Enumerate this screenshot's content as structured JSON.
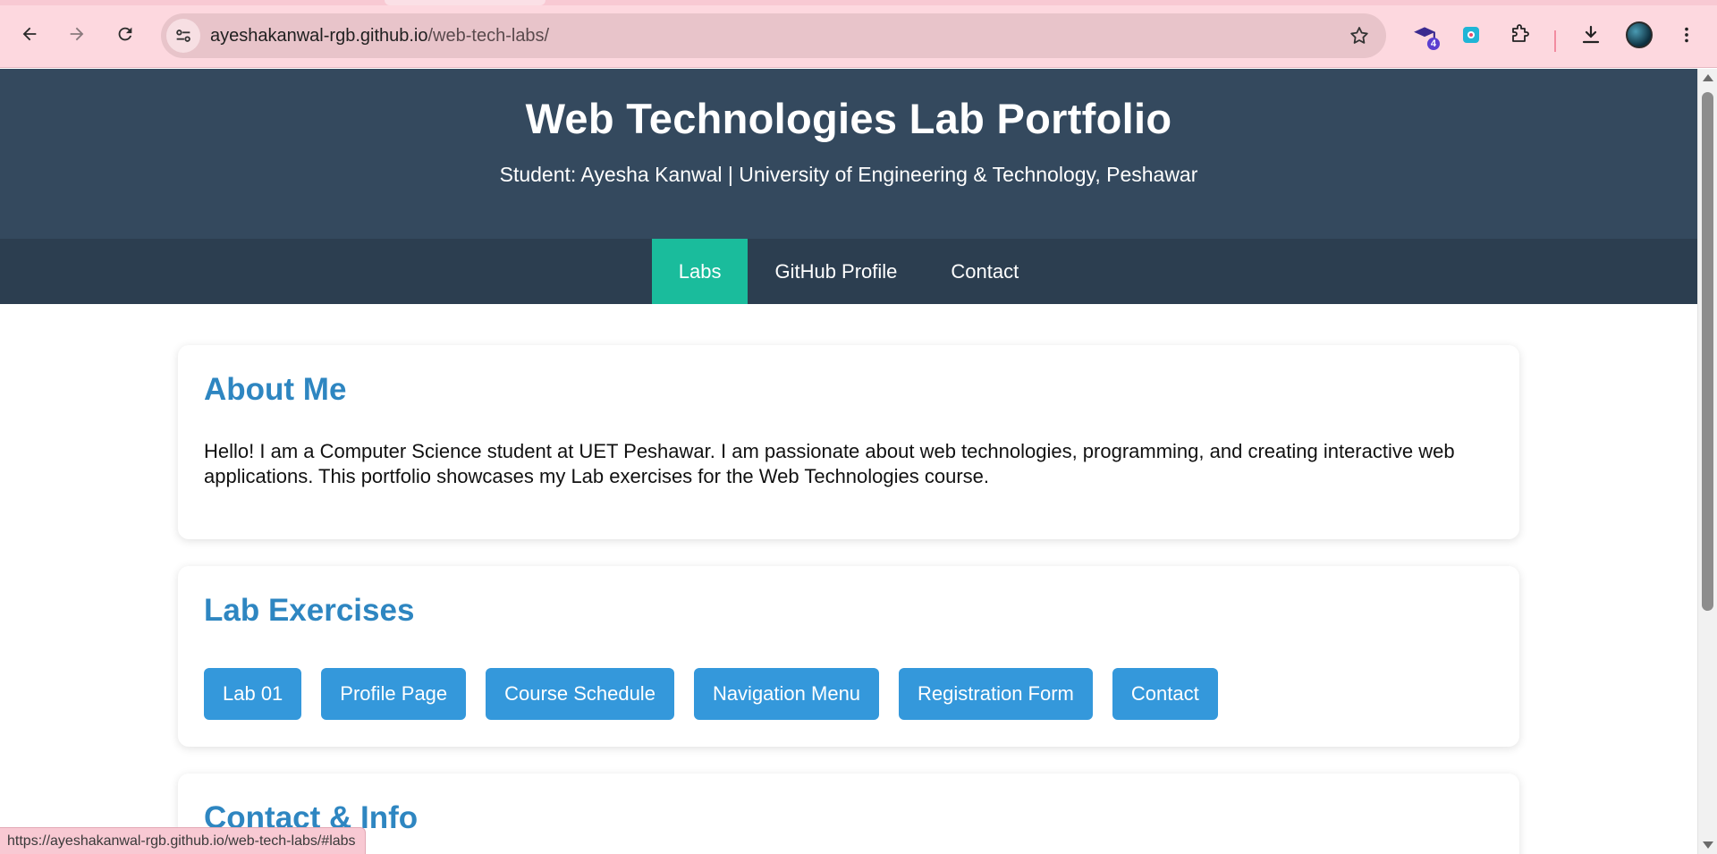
{
  "browser": {
    "url_host": "ayeshakanwal-rgb.github.io",
    "url_path": "/web-tech-labs/",
    "extension_badge": "4",
    "status_url": "https://ayeshakanwal-rgb.github.io/web-tech-labs/#labs",
    "accent_color": "#fdd8df"
  },
  "header": {
    "title": "Web Technologies Lab Portfolio",
    "subtitle": "Student: Ayesha Kanwal | University of Engineering & Technology, Peshawar"
  },
  "nav": {
    "items": [
      {
        "label": "Labs",
        "active": true
      },
      {
        "label": "GitHub Profile",
        "active": false
      },
      {
        "label": "Contact",
        "active": false
      }
    ]
  },
  "about": {
    "heading": "About Me",
    "text": "Hello! I am a Computer Science student at UET Peshawar. I am passionate about web technologies, programming, and creating interactive web applications. This portfolio showcases my Lab exercises for the Web Technologies course."
  },
  "labs": {
    "heading": "Lab Exercises",
    "buttons": [
      {
        "label": "Lab 01"
      },
      {
        "label": "Profile Page"
      },
      {
        "label": "Course Schedule"
      },
      {
        "label": "Navigation Menu"
      },
      {
        "label": "Registration Form"
      },
      {
        "label": "Contact"
      }
    ]
  },
  "contact": {
    "heading": "Contact & Info"
  },
  "colors": {
    "header_bg": "#34495e",
    "nav_bg": "#2c3e50",
    "nav_active": "#1abc9c",
    "heading": "#2e86c1",
    "button": "#3498db"
  }
}
